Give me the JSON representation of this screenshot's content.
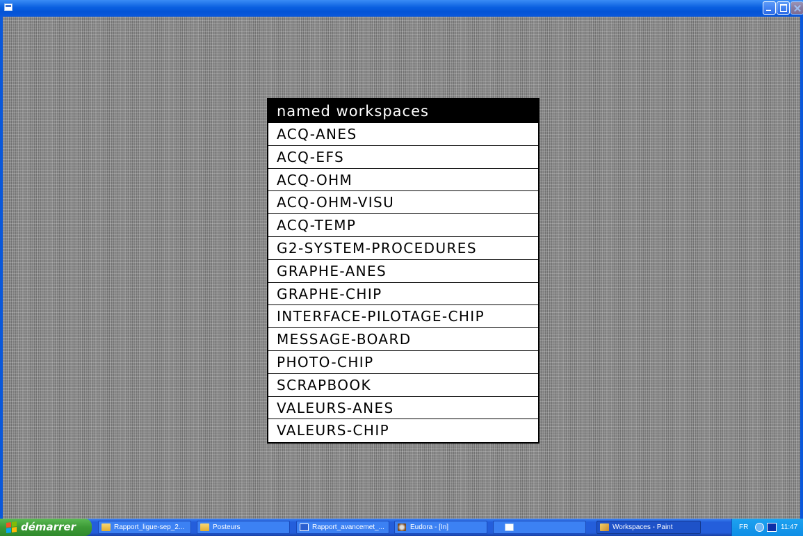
{
  "window": {
    "icon": "app-window-icon",
    "controls": [
      "minimize",
      "maximize",
      "close"
    ]
  },
  "menu": {
    "title": "named workspaces",
    "items": [
      "ACQ-ANES",
      "ACQ-EFS",
      "ACQ-OHM",
      "ACQ-OHM-VISU",
      "ACQ-TEMP",
      "G2-SYSTEM-PROCEDURES",
      "GRAPHE-ANES",
      "GRAPHE-CHIP",
      "INTERFACE-PILOTAGE-CHIP",
      "MESSAGE-BOARD",
      "PHOTO-CHIP",
      "SCRAPBOOK",
      "VALEURS-ANES",
      "VALEURS-CHIP"
    ]
  },
  "taskbar": {
    "start_label": "démarrer",
    "tasks": [
      {
        "label": "Rapport_ligue-sep_2...",
        "icon": "folder-icon"
      },
      {
        "label": "Posteurs",
        "icon": "folder-icon"
      },
      {
        "label": "Rapport_avancemet_...",
        "icon": "word-doc-icon"
      },
      {
        "label": "Eudora - [In]",
        "icon": "eudora-icon"
      },
      {
        "label": "",
        "icon": "app-window-icon"
      },
      {
        "label": "Workspaces - Paint",
        "icon": "paint-icon"
      }
    ],
    "tray": {
      "language": "FR",
      "clock": "11:47"
    }
  },
  "colors": {
    "titlebar": "#0a5fe0",
    "menu_header_bg": "#000000",
    "menu_bg": "#ffffff",
    "workspace_bg": "#8a8a8a"
  }
}
